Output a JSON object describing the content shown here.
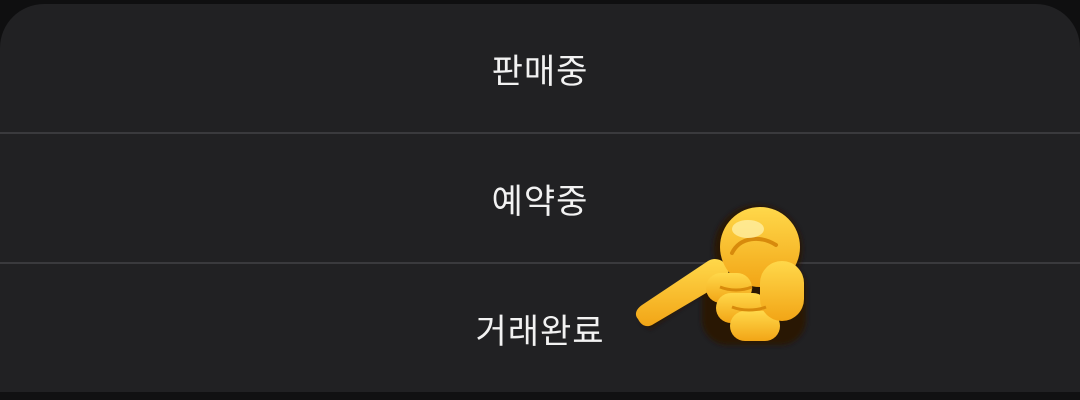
{
  "status_sheet": {
    "options": [
      {
        "label": "판매중"
      },
      {
        "label": "예약중"
      },
      {
        "label": "거래완료"
      }
    ]
  },
  "overlay": {
    "icon": "backhand-index-pointing-left-icon",
    "color": "#f5b81c"
  }
}
